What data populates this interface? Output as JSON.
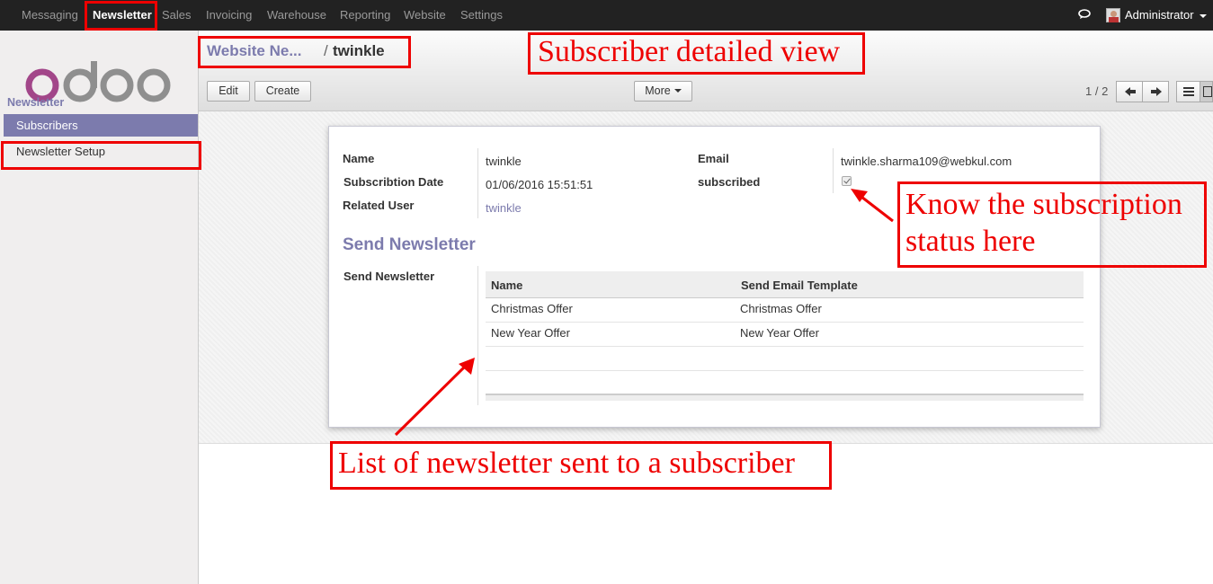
{
  "topbar": {
    "menu": [
      "Messaging",
      "Newsletter",
      "Sales",
      "Invoicing",
      "Warehouse",
      "Reporting",
      "Website",
      "Settings"
    ],
    "active_index": 1,
    "user_name": "Administrator"
  },
  "sidebar": {
    "section": "Newsletter",
    "items": [
      "Subscribers",
      "Newsletter Setup"
    ],
    "active_index": 0
  },
  "breadcrumb": {
    "parent": "Website Ne...",
    "separator": "/",
    "current": "twinkle"
  },
  "buttons": {
    "edit": "Edit",
    "create": "Create",
    "more": "More"
  },
  "pager": {
    "value": "1 / 2"
  },
  "form": {
    "name_label": "Name",
    "name_value": "twinkle",
    "subscription_date_label": "Subscribtion Date",
    "subscription_date_value": "01/06/2016 15:51:51",
    "related_user_label": "Related User",
    "related_user_value": "twinkle",
    "email_label": "Email",
    "email_value": "twinkle.sharma109@webkul.com",
    "subscribed_label": "subscribed",
    "subscribed_value": true,
    "section_title": "Send Newsletter",
    "send_newsletter_label": "Send Newsletter",
    "table": {
      "columns": [
        "Name",
        "Send Email Template"
      ],
      "rows": [
        [
          "Christmas Offer",
          "Christmas Offer"
        ],
        [
          "New Year Offer",
          "New Year Offer"
        ]
      ]
    }
  },
  "annotations": {
    "title": "Subscriber detailed view",
    "status_line1": "Know the subscription",
    "status_line2": "status here",
    "list": "List of newsletter sent to a subscriber"
  },
  "colors": {
    "brand": "#7c7bad",
    "topbar": "#222222",
    "annotation": "#ee0000"
  },
  "icons": [
    "chat-icon",
    "user-avatar",
    "odoo-logo",
    "prev-arrow-icon",
    "next-arrow-icon",
    "list-view-icon",
    "form-view-icon",
    "checkbox-icon"
  ]
}
